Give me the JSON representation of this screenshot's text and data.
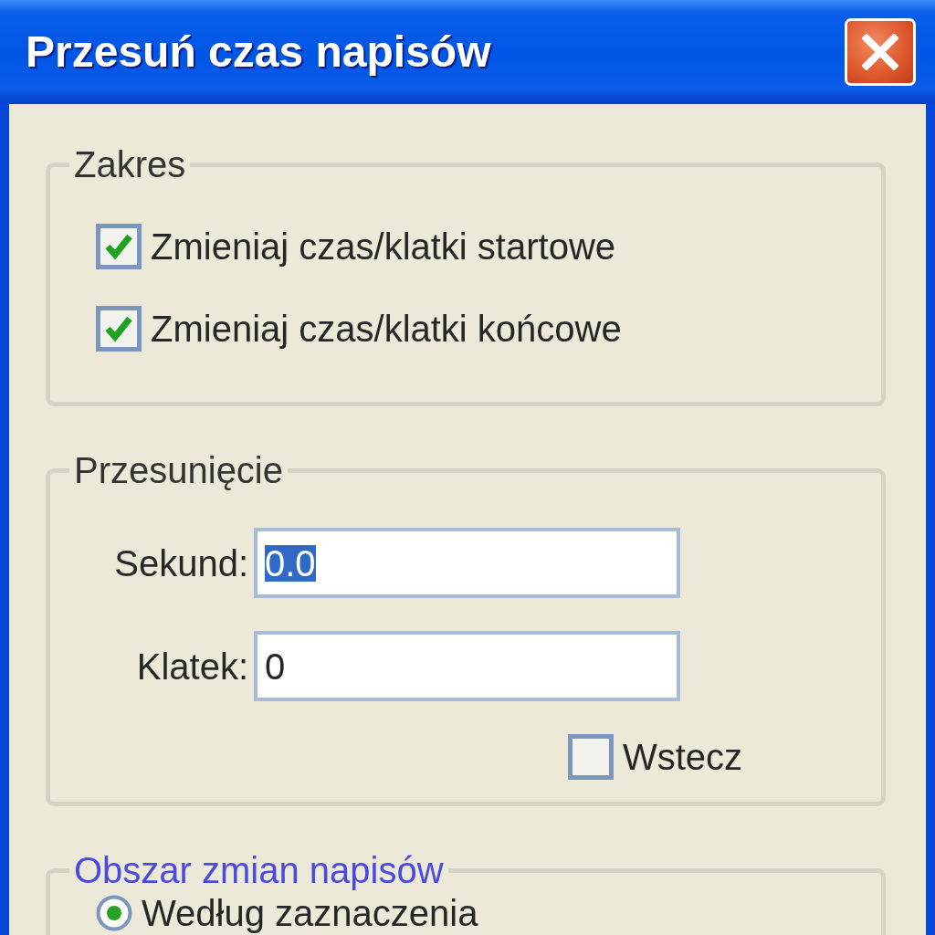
{
  "window": {
    "title": "Przesuń czas napisów"
  },
  "groups": [
    {
      "kind": "checks",
      "label": "Zakres",
      "color": "#333333",
      "checkboxes": [
        {
          "label": "Zmieniaj czas/klatki startowe",
          "checked": true
        },
        {
          "label": "Zmieniaj czas/klatki końcowe",
          "checked": true
        }
      ]
    },
    {
      "kind": "fields",
      "label": "Przesunięcie",
      "color": "#333333",
      "fields": [
        {
          "label": "Sekund:",
          "value": "0.0",
          "value_selected": true
        },
        {
          "label": "Klatek:",
          "value": "0",
          "value_selected": false
        }
      ],
      "checkbox": {
        "label": "Wstecz",
        "checked": false
      }
    },
    {
      "kind": "radios",
      "label": "Obszar zmian napisów",
      "color": "#4a4ae0",
      "radios": [
        {
          "label": "Według zaznaczenia",
          "selected": true
        }
      ]
    }
  ]
}
